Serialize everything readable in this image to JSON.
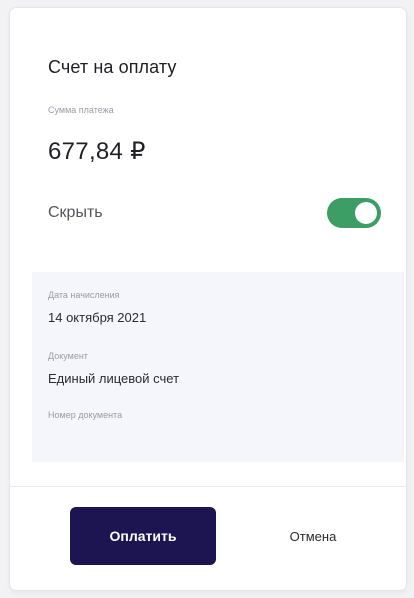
{
  "dialog": {
    "title": "Счет на оплату",
    "amount_label": "Сумма платежа",
    "amount_value": "677,84 ₽",
    "hide_label": "Скрыть",
    "hide_toggle_on": true
  },
  "details": {
    "accrual_date_label": "Дата начисления",
    "accrual_date_value": "14 октября 2021",
    "document_label": "Документ",
    "document_value": "Единый лицевой счет",
    "document_number_label": "Номер документа"
  },
  "actions": {
    "pay_label": "Оплатить",
    "cancel_label": "Отмена"
  },
  "colors": {
    "toggle_on": "#3c9e64",
    "primary_button": "#1c1552"
  }
}
